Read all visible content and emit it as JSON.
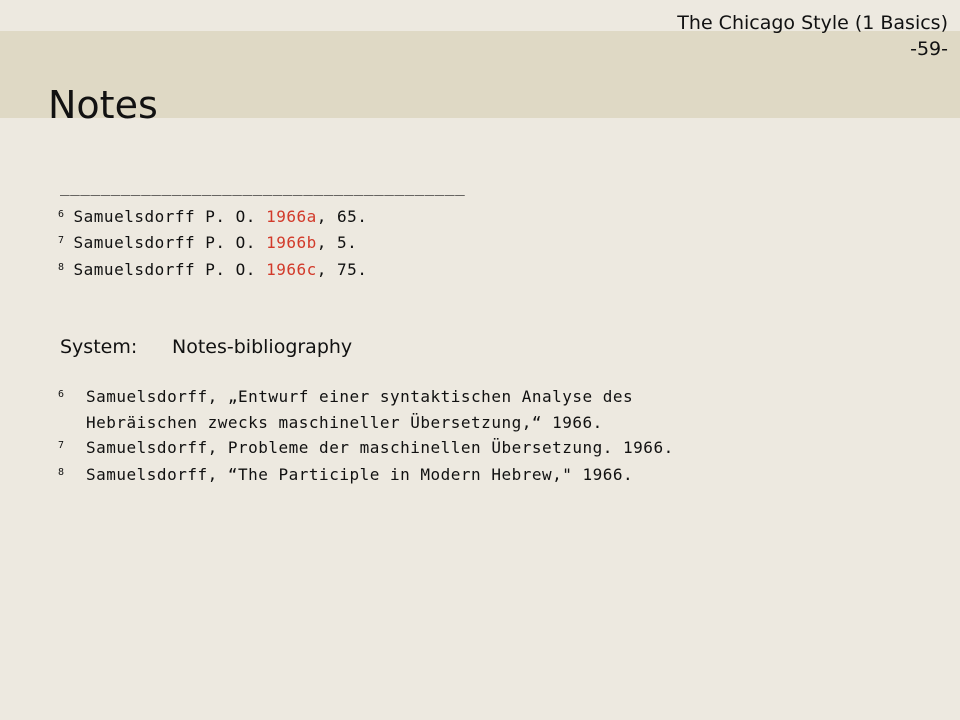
{
  "header": {
    "line1": "The Chicago Style (1 Basics)",
    "line2": "-59-"
  },
  "title": "Notes",
  "divider": "________________________________________",
  "short_notes": [
    {
      "num": "6",
      "author": "Samuelsdorff P. O. ",
      "year": "1966a",
      "rest": ", 65."
    },
    {
      "num": "7",
      "author": "Samuelsdorff P. O. ",
      "year": "1966b",
      "rest": ", 5."
    },
    {
      "num": "8",
      "author": "Samuelsdorff P. O. ",
      "year": "1966c",
      "rest": ", 75."
    }
  ],
  "system": {
    "label": "System:",
    "value": "Notes-bibliography"
  },
  "bibliography_notes": [
    {
      "num": "6",
      "line1": "Samuelsdorff, „Entwurf einer syntaktischen Analyse des",
      "line2": "Hebräischen zwecks maschineller Übersetzung,“ 1966."
    },
    {
      "num": "7",
      "line1": "Samuelsdorff, Probleme der maschinellen Übersetzung. 1966."
    },
    {
      "num": "8",
      "line1": "Samuelsdorff, “The Participle in Modern Hebrew,\" 1966."
    }
  ],
  "colors": {
    "background": "#ede9e0",
    "title_band": "#dfd9c5",
    "year_highlight": "#d23a2a"
  }
}
